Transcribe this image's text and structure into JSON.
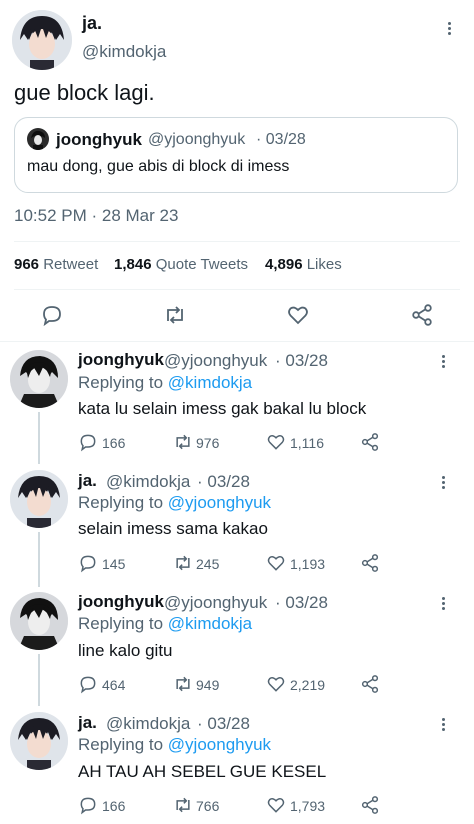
{
  "main_tweet": {
    "display_name": "ja.",
    "handle": "@kimdokja",
    "text": "gue block lagi.",
    "timestamp": "10:52 PM · 28 Mar 23",
    "quote": {
      "display_name": "joonghyuk",
      "handle": "@yjoonghyuk",
      "date": "· 03/28",
      "text": "mau dong, gue abis di block di imess"
    },
    "stats": {
      "retweets": "966",
      "retweets_label": "Retweet",
      "quotes": "1,846",
      "quotes_label": "Quote Tweets",
      "likes": "4,896",
      "likes_label": "Likes"
    }
  },
  "replies": [
    {
      "display_name": "joonghyuk",
      "handle": "@yjoonghyuk",
      "date": "· 03/28",
      "replying_to": "Replying to",
      "replying_handle": "@kimdokja",
      "text": "kata lu selain imess gak bakal lu block",
      "replies": "166",
      "retweets": "976",
      "likes": "1,116"
    },
    {
      "display_name": "ja.",
      "handle": "@kimdokja",
      "date": "· 03/28",
      "replying_to": "Replying to",
      "replying_handle": "@yjoonghyuk",
      "text": "selain imess sama kakao",
      "replies": "145",
      "retweets": "245",
      "likes": "1,193"
    },
    {
      "display_name": "joonghyuk",
      "handle": "@yjoonghyuk",
      "date": "· 03/28",
      "replying_to": "Replying to",
      "replying_handle": "@kimdokja",
      "text": "line kalo gitu",
      "replies": "464",
      "retweets": "949",
      "likes": "2,219"
    },
    {
      "display_name": "ja.",
      "handle": "@kimdokja",
      "date": "· 03/28",
      "replying_to": "Replying to",
      "replying_handle": "@yjoonghyuk",
      "text": "AH TAU AH SEBEL GUE KESEL",
      "replies": "166",
      "retweets": "766",
      "likes": "1,793"
    }
  ],
  "colors": {
    "accent": "#1d9bf0",
    "secondary_text": "#536471",
    "divider": "#eff3f4"
  },
  "icons": [
    "more-icon",
    "reply-icon",
    "retweet-icon",
    "like-icon",
    "share-icon"
  ]
}
